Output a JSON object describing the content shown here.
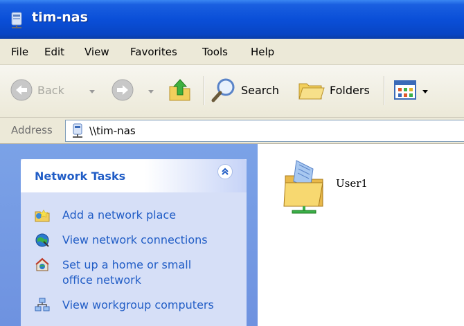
{
  "window": {
    "title": "tim-nas"
  },
  "menu": [
    "File",
    "Edit",
    "View",
    "Favorites",
    "Tools",
    "Help"
  ],
  "toolbar": {
    "back_label": "Back",
    "search_label": "Search",
    "folders_label": "Folders"
  },
  "address": {
    "label": "Address",
    "value": "\\\\tim-nas"
  },
  "tasks": {
    "title": "Network Tasks",
    "items": [
      {
        "label": "Add a network place",
        "icon": "add-network-place-icon"
      },
      {
        "label": "View network connections",
        "icon": "network-connections-icon"
      },
      {
        "label_line1": "Set up a home or small",
        "label_line2": "office network",
        "icon": "home-network-setup-icon"
      },
      {
        "label": "View workgroup computers",
        "icon": "workgroup-computers-icon"
      }
    ]
  },
  "content": {
    "items": [
      {
        "label": "User1",
        "icon": "shared-folder-icon"
      }
    ]
  },
  "colors": {
    "titlebar": "#0a4fd8",
    "task_link": "#215dc6",
    "task_panel": "#d6dff7",
    "left_pane": "#7ba2e7"
  }
}
